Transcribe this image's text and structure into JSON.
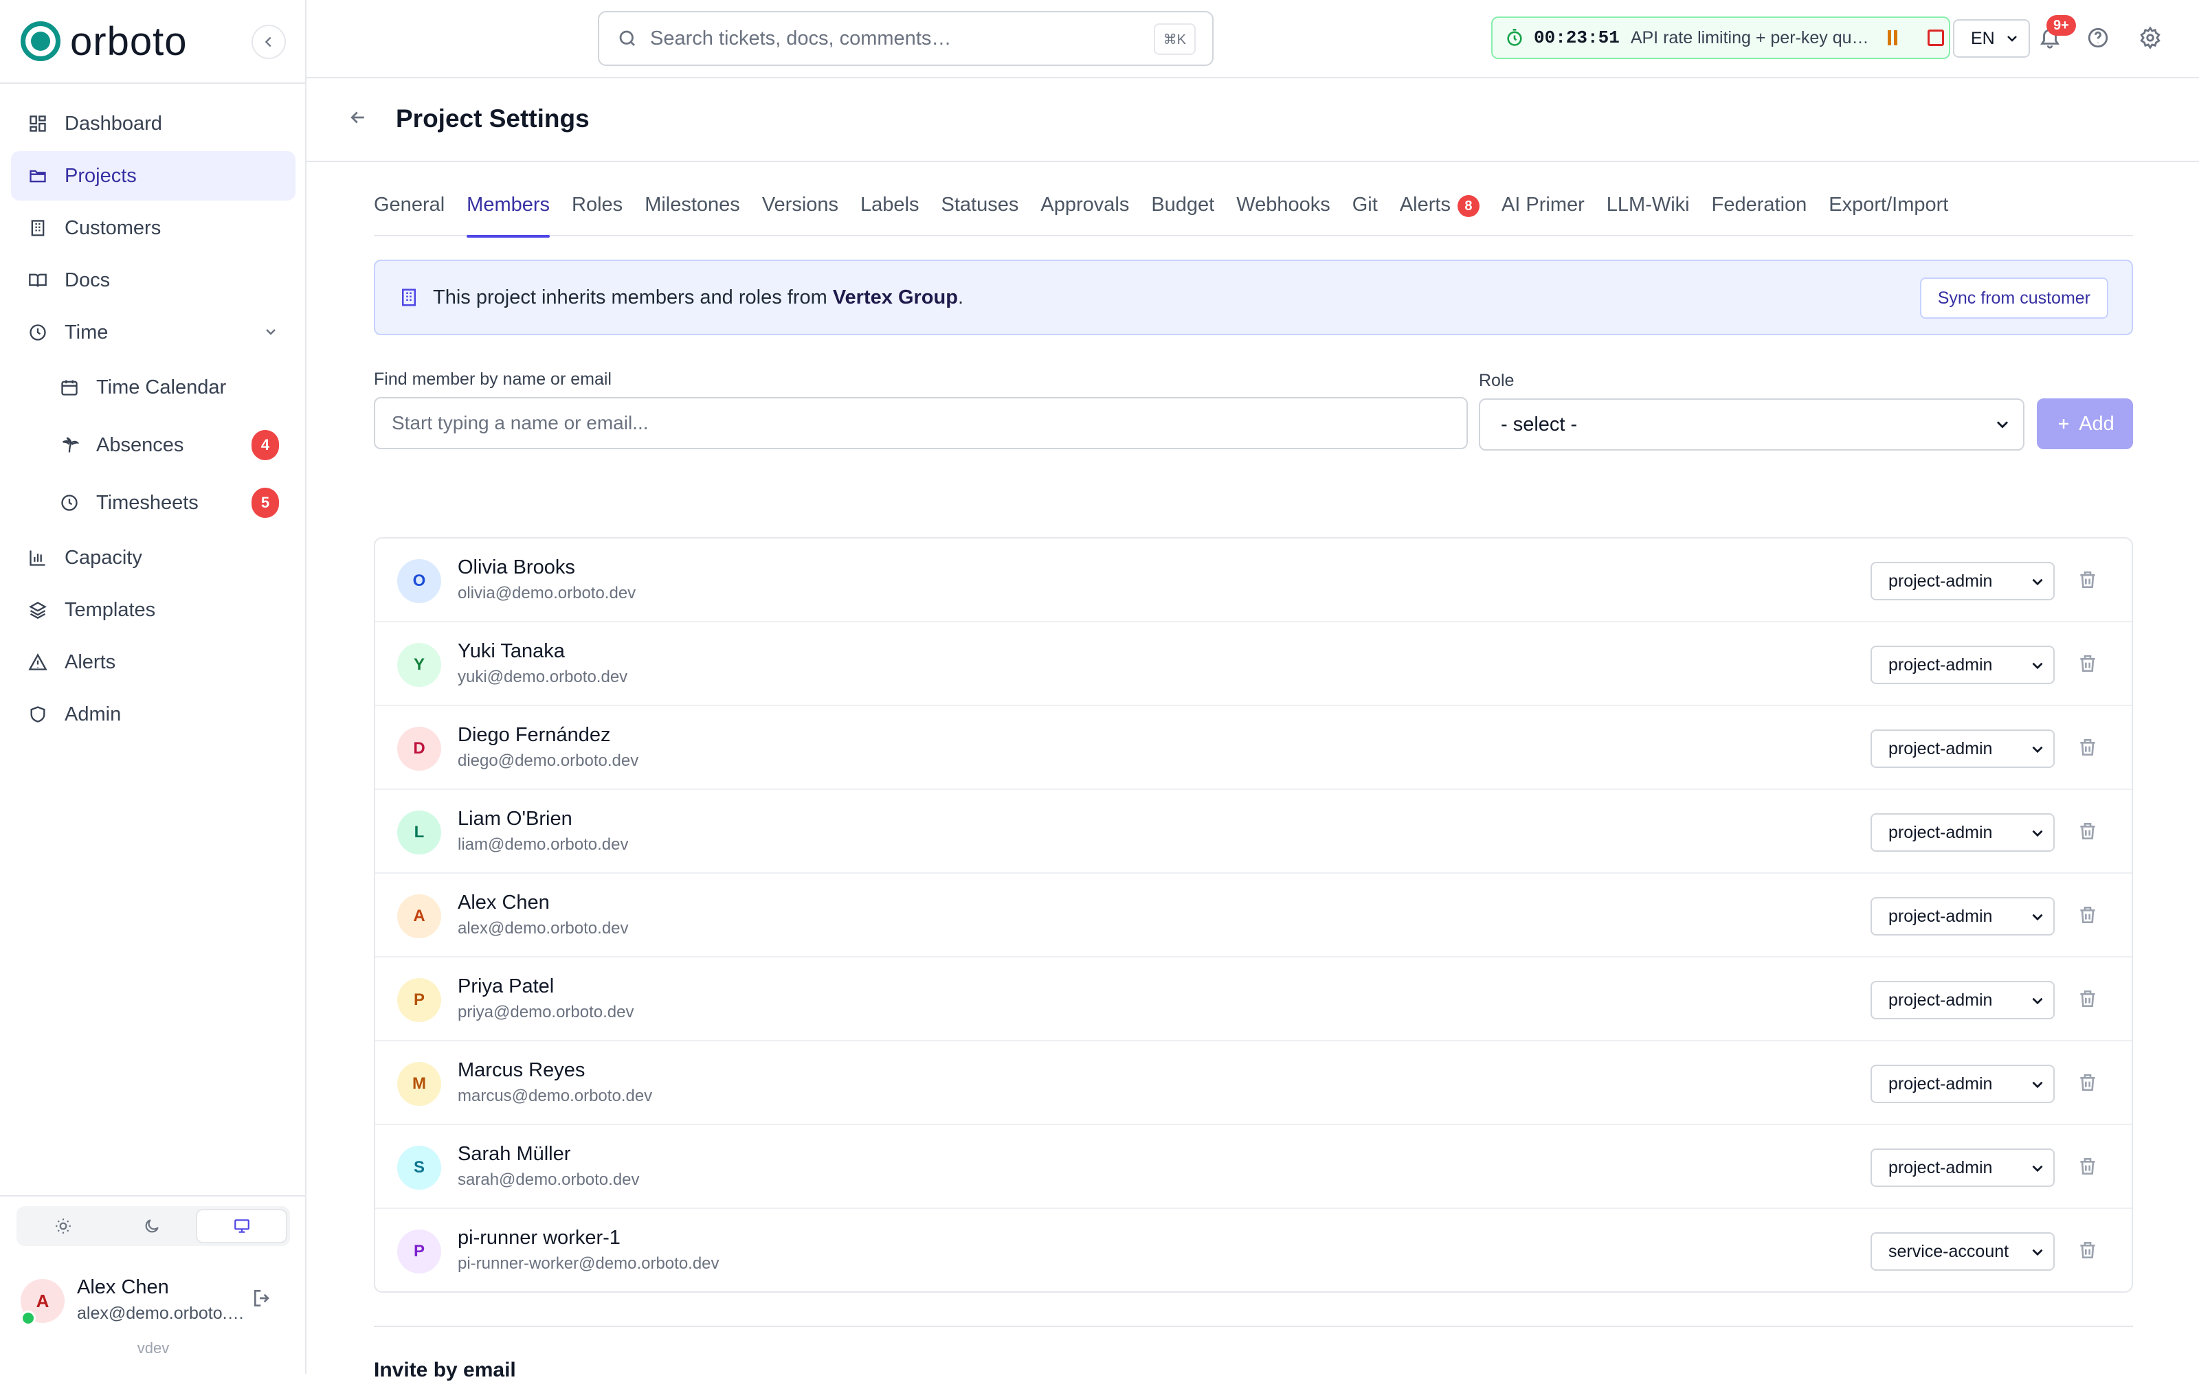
{
  "app": {
    "name": "orboto",
    "env": "vdev"
  },
  "sidebar": {
    "items": [
      {
        "label": "Dashboard",
        "icon": "dashboard-icon"
      },
      {
        "label": "Projects",
        "icon": "folder-icon",
        "active": true
      },
      {
        "label": "Customers",
        "icon": "building-icon"
      },
      {
        "label": "Docs",
        "icon": "book-icon"
      },
      {
        "label": "Time",
        "icon": "clock-icon"
      },
      {
        "label": "Time Calendar",
        "icon": "calendar-icon"
      },
      {
        "label": "Absences",
        "icon": "palm-tree-icon",
        "badge": "4"
      },
      {
        "label": "Timesheets",
        "icon": "clock-icon",
        "badge": "5"
      },
      {
        "label": "Capacity",
        "icon": "bar-chart-icon"
      },
      {
        "label": "Templates",
        "icon": "layers-icon"
      },
      {
        "label": "Alerts",
        "icon": "warning-icon"
      },
      {
        "label": "Admin",
        "icon": "shield-icon"
      }
    ]
  },
  "user": {
    "initial": "A",
    "name": "Alex Chen",
    "email": "alex@demo.orboto.dev"
  },
  "topbar": {
    "search_placeholder": "Search tickets, docs, comments…",
    "shortcut": "⌘K",
    "timer_time": "00:23:51",
    "timer_task": "API rate limiting + per-key quotas",
    "language": "EN",
    "notifications_badge": "9+"
  },
  "page": {
    "title": "Project Settings"
  },
  "tabs": [
    {
      "label": "General"
    },
    {
      "label": "Members",
      "active": true
    },
    {
      "label": "Roles"
    },
    {
      "label": "Milestones"
    },
    {
      "label": "Versions"
    },
    {
      "label": "Labels"
    },
    {
      "label": "Statuses"
    },
    {
      "label": "Approvals"
    },
    {
      "label": "Budget"
    },
    {
      "label": "Webhooks"
    },
    {
      "label": "Git"
    },
    {
      "label": "Alerts",
      "badge": "8"
    },
    {
      "label": "AI Primer"
    },
    {
      "label": "LLM-Wiki"
    },
    {
      "label": "Federation"
    },
    {
      "label": "Export/Import"
    }
  ],
  "banner": {
    "text_before": "This project inherits members and roles from ",
    "customer": "Vertex Group",
    "text_after": ".",
    "sync_label": "Sync from customer"
  },
  "find": {
    "label": "Find member by name or email",
    "placeholder": "Start typing a name or email...",
    "role_label": "Role",
    "role_value": "- select -",
    "add_label": "Add"
  },
  "members": [
    {
      "initial": "O",
      "name": "Olivia Brooks",
      "email": "olivia@demo.orboto.dev",
      "role": "project-admin",
      "bg": "#dbeafe",
      "fg": "#1d4ed8"
    },
    {
      "initial": "Y",
      "name": "Yuki Tanaka",
      "email": "yuki@demo.orboto.dev",
      "role": "project-admin",
      "bg": "#dcfce7",
      "fg": "#15803d"
    },
    {
      "initial": "D",
      "name": "Diego Fernández",
      "email": "diego@demo.orboto.dev",
      "role": "project-admin",
      "bg": "#fee2e2",
      "fg": "#be123c"
    },
    {
      "initial": "L",
      "name": "Liam O'Brien",
      "email": "liam@demo.orboto.dev",
      "role": "project-admin",
      "bg": "#d1fae5",
      "fg": "#047857"
    },
    {
      "initial": "A",
      "name": "Alex Chen",
      "email": "alex@demo.orboto.dev",
      "role": "project-admin",
      "bg": "#ffedd5",
      "fg": "#c2410c"
    },
    {
      "initial": "P",
      "name": "Priya Patel",
      "email": "priya@demo.orboto.dev",
      "role": "project-admin",
      "bg": "#fef3c7",
      "fg": "#b45309"
    },
    {
      "initial": "M",
      "name": "Marcus Reyes",
      "email": "marcus@demo.orboto.dev",
      "role": "project-admin",
      "bg": "#fef3c7",
      "fg": "#b45309"
    },
    {
      "initial": "S",
      "name": "Sarah Müller",
      "email": "sarah@demo.orboto.dev",
      "role": "project-admin",
      "bg": "#cffafe",
      "fg": "#0e7490"
    },
    {
      "initial": "P",
      "name": "pi-runner worker-1",
      "email": "pi-runner-worker@demo.orboto.dev",
      "role": "service-account",
      "bg": "#f3e8ff",
      "fg": "#7e22ce"
    }
  ],
  "invite": {
    "title": "Invite by email"
  }
}
